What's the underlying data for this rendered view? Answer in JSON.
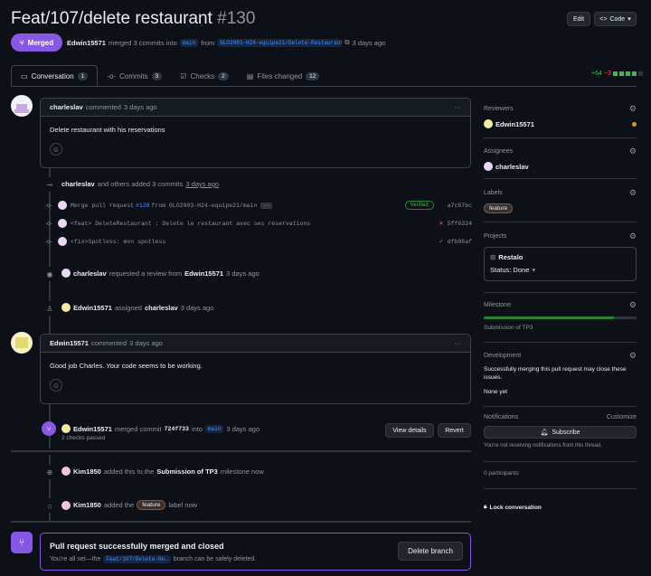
{
  "header": {
    "title": "Feat/107/delete restaurant",
    "number": "#130",
    "edit_label": "Edit",
    "code_label": "Code",
    "status": "Merged",
    "author": "Edwin15571",
    "merged_text": "merged 3 commits into",
    "base_branch": "main",
    "from_text": "from",
    "head_branch": "GLO2003-H24-equipe21/Delete-Restaurant-With-Reservations",
    "time": "3 days ago"
  },
  "tabs": [
    {
      "label": "Conversation",
      "count": "1",
      "icon": "comment-icon"
    },
    {
      "label": "Commits",
      "count": "3",
      "icon": "commit-icon"
    },
    {
      "label": "Checks",
      "count": "2",
      "icon": "checklist-icon"
    },
    {
      "label": "Files changed",
      "count": "12",
      "icon": "file-diff-icon"
    }
  ],
  "diffstat": {
    "additions": "+64",
    "deletions": "−3"
  },
  "timeline": {
    "comment1": {
      "author": "charleslav",
      "action": "commented",
      "time": "3 days ago",
      "body": "Delete restaurant with his reservations"
    },
    "commits_event": {
      "author": "charleslav",
      "text": "and others added 3 commits",
      "time": "3 days ago"
    },
    "commits": [
      {
        "message_prefix": "Merge pull request",
        "link": "#128",
        "message_suffix": "from GLO2003-H24-equipe21/main",
        "badge": "Verified",
        "sha": "a7c67bc"
      },
      {
        "message": "<feat> DeleteRestaurant : Delete le restaurant avec ses réservations",
        "status": "✕",
        "sha": "5ff6324"
      },
      {
        "message": "<fix>Spotless: mvn spotless",
        "status": "✓",
        "sha": "dfb08af"
      }
    ],
    "review_event": {
      "author": "charleslav",
      "text": "requested a review from",
      "target": "Edwin15571",
      "time": "3 days ago"
    },
    "assign_event": {
      "author": "Edwin15571",
      "text": "assigned",
      "target": "charleslav",
      "time": "3 days ago"
    },
    "comment2": {
      "author": "Edwin15571",
      "action": "commented",
      "time": "3 days ago",
      "body": "Good job Charles. Your code seems to be working."
    },
    "merge_event": {
      "author": "Edwin15571",
      "text": "merged commit",
      "sha": "724f733",
      "into": "into",
      "branch": "main",
      "time": "3 days ago",
      "checks": "2 checks passed",
      "view_details": "View details",
      "revert": "Revert"
    },
    "milestone_event": {
      "author": "Kim1850",
      "text": "added this to the",
      "milestone": "Submission of TP3",
      "suffix": "milestone now"
    },
    "label_event": {
      "author": "Kim1850",
      "text": "added the",
      "label": "feature",
      "suffix": "label now"
    },
    "merged_box": {
      "title": "Pull request successfully merged and closed",
      "prefix": "You're all set—the",
      "branch": "Feat/107/Delete-Re…",
      "suffix": "branch can be safely deleted.",
      "button": "Delete branch"
    }
  },
  "sidebar": {
    "reviewers": {
      "title": "Reviewers",
      "name": "Edwin15571"
    },
    "assignees": {
      "title": "Assignees",
      "name": "charleslav"
    },
    "labels": {
      "title": "Labels",
      "label": "feature"
    },
    "projects": {
      "title": "Projects",
      "project": "Restalo",
      "status": "Status: Done"
    },
    "milestone": {
      "title": "Milestone",
      "name": "Submission of TP3",
      "progress": 0.85
    },
    "development": {
      "title": "Development",
      "text": "Successfully merging this pull request may close these issues.",
      "none": "None yet"
    },
    "notifications": {
      "title": "Notifications",
      "customize": "Customize",
      "subscribe": "Subscribe",
      "note": "You're not receiving notifications from this thread."
    },
    "participants": "0 participants",
    "lock": "Lock conversation"
  },
  "colors": {
    "merged": "#8957e5",
    "link": "#4493f8",
    "success": "#3fb950",
    "danger": "#f85149"
  }
}
